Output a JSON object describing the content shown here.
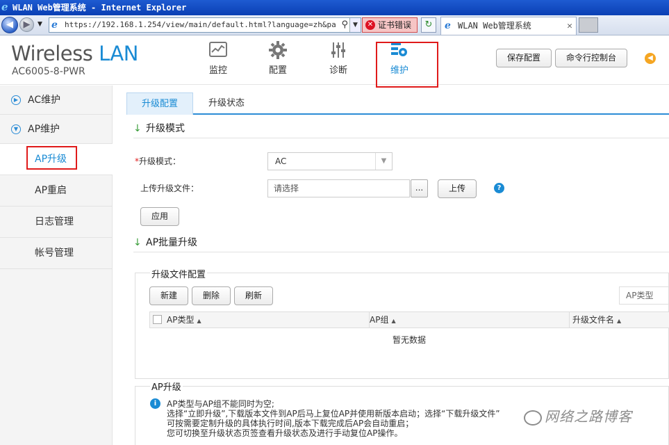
{
  "browser": {
    "window_title": "WLAN Web管理系统 - Internet Explorer",
    "url": "https://192.168.1.254/view/main/default.html?language=zh&pageid=9",
    "cert_error": "证书错误",
    "tab_title": "WLAN Web管理系统"
  },
  "header": {
    "brand_main": "Wireless",
    "brand_accent": "LAN",
    "model": "AC6005-8-PWR",
    "nav": [
      {
        "label": "监控",
        "icon": "monitor-icon"
      },
      {
        "label": "配置",
        "icon": "gear-icon"
      },
      {
        "label": "诊断",
        "icon": "sliders-icon"
      },
      {
        "label": "维护",
        "icon": "maintenance-icon",
        "active": true
      }
    ],
    "save_config": "保存配置",
    "cli_console": "命令行控制台"
  },
  "sidebar": {
    "ac_maint": "AC维护",
    "ap_maint": "AP维护",
    "items": [
      "AP升级",
      "AP重启",
      "日志管理",
      "帐号管理"
    ],
    "active_item": "AP升级"
  },
  "tabs": [
    "升级配置",
    "升级状态"
  ],
  "upgrade_mode": {
    "section_title": "升级模式",
    "mode_label": "升级模式：",
    "mode_value": "AC",
    "file_label": "上传升级文件：",
    "file_placeholder": "请选择",
    "browse_label": "...",
    "upload_label": "上传",
    "apply_label": "应用"
  },
  "batch": {
    "section_title": "AP批量升级",
    "file_config_title": "升级文件配置",
    "new_label": "新建",
    "delete_label": "删除",
    "refresh_label": "刷新",
    "filter_placeholder": "AP类型",
    "columns": [
      "AP类型",
      "AP组",
      "升级文件名"
    ],
    "no_data": "暂无数据"
  },
  "ap_upgrade": {
    "title": "AP升级",
    "info_lines": [
      "AP类型与AP组不能同时为空;",
      "选择“立即升级”,下载版本文件到AP后马上复位AP并使用新版本启动；选择“下载升级文件”",
      "可按需要定制升级的具体执行时间,版本下载完成后AP会自动重启；",
      "您可切换至升级状态页签查看升级状态及进行手动复位AP操作。"
    ]
  },
  "watermark": "网络之路博客",
  "colors": {
    "accent": "#1a8bd4",
    "highlight": "#e01a1a"
  }
}
